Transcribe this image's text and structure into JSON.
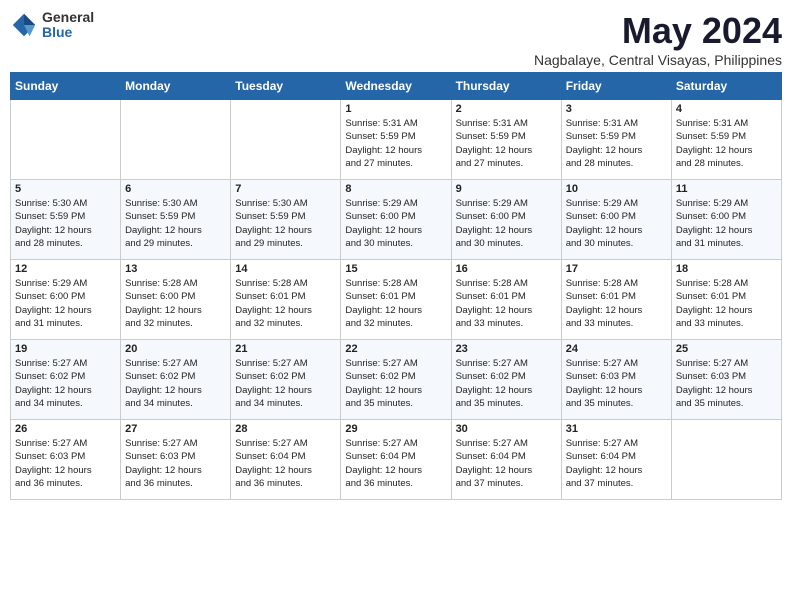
{
  "logo": {
    "general": "General",
    "blue": "Blue"
  },
  "title": "May 2024",
  "subtitle": "Nagbalaye, Central Visayas, Philippines",
  "days_header": [
    "Sunday",
    "Monday",
    "Tuesday",
    "Wednesday",
    "Thursday",
    "Friday",
    "Saturday"
  ],
  "weeks": [
    [
      {
        "num": "",
        "text": ""
      },
      {
        "num": "",
        "text": ""
      },
      {
        "num": "",
        "text": ""
      },
      {
        "num": "1",
        "text": "Sunrise: 5:31 AM\nSunset: 5:59 PM\nDaylight: 12 hours\nand 27 minutes."
      },
      {
        "num": "2",
        "text": "Sunrise: 5:31 AM\nSunset: 5:59 PM\nDaylight: 12 hours\nand 27 minutes."
      },
      {
        "num": "3",
        "text": "Sunrise: 5:31 AM\nSunset: 5:59 PM\nDaylight: 12 hours\nand 28 minutes."
      },
      {
        "num": "4",
        "text": "Sunrise: 5:31 AM\nSunset: 5:59 PM\nDaylight: 12 hours\nand 28 minutes."
      }
    ],
    [
      {
        "num": "5",
        "text": "Sunrise: 5:30 AM\nSunset: 5:59 PM\nDaylight: 12 hours\nand 28 minutes."
      },
      {
        "num": "6",
        "text": "Sunrise: 5:30 AM\nSunset: 5:59 PM\nDaylight: 12 hours\nand 29 minutes."
      },
      {
        "num": "7",
        "text": "Sunrise: 5:30 AM\nSunset: 5:59 PM\nDaylight: 12 hours\nand 29 minutes."
      },
      {
        "num": "8",
        "text": "Sunrise: 5:29 AM\nSunset: 6:00 PM\nDaylight: 12 hours\nand 30 minutes."
      },
      {
        "num": "9",
        "text": "Sunrise: 5:29 AM\nSunset: 6:00 PM\nDaylight: 12 hours\nand 30 minutes."
      },
      {
        "num": "10",
        "text": "Sunrise: 5:29 AM\nSunset: 6:00 PM\nDaylight: 12 hours\nand 30 minutes."
      },
      {
        "num": "11",
        "text": "Sunrise: 5:29 AM\nSunset: 6:00 PM\nDaylight: 12 hours\nand 31 minutes."
      }
    ],
    [
      {
        "num": "12",
        "text": "Sunrise: 5:29 AM\nSunset: 6:00 PM\nDaylight: 12 hours\nand 31 minutes."
      },
      {
        "num": "13",
        "text": "Sunrise: 5:28 AM\nSunset: 6:00 PM\nDaylight: 12 hours\nand 32 minutes."
      },
      {
        "num": "14",
        "text": "Sunrise: 5:28 AM\nSunset: 6:01 PM\nDaylight: 12 hours\nand 32 minutes."
      },
      {
        "num": "15",
        "text": "Sunrise: 5:28 AM\nSunset: 6:01 PM\nDaylight: 12 hours\nand 32 minutes."
      },
      {
        "num": "16",
        "text": "Sunrise: 5:28 AM\nSunset: 6:01 PM\nDaylight: 12 hours\nand 33 minutes."
      },
      {
        "num": "17",
        "text": "Sunrise: 5:28 AM\nSunset: 6:01 PM\nDaylight: 12 hours\nand 33 minutes."
      },
      {
        "num": "18",
        "text": "Sunrise: 5:28 AM\nSunset: 6:01 PM\nDaylight: 12 hours\nand 33 minutes."
      }
    ],
    [
      {
        "num": "19",
        "text": "Sunrise: 5:27 AM\nSunset: 6:02 PM\nDaylight: 12 hours\nand 34 minutes."
      },
      {
        "num": "20",
        "text": "Sunrise: 5:27 AM\nSunset: 6:02 PM\nDaylight: 12 hours\nand 34 minutes."
      },
      {
        "num": "21",
        "text": "Sunrise: 5:27 AM\nSunset: 6:02 PM\nDaylight: 12 hours\nand 34 minutes."
      },
      {
        "num": "22",
        "text": "Sunrise: 5:27 AM\nSunset: 6:02 PM\nDaylight: 12 hours\nand 35 minutes."
      },
      {
        "num": "23",
        "text": "Sunrise: 5:27 AM\nSunset: 6:02 PM\nDaylight: 12 hours\nand 35 minutes."
      },
      {
        "num": "24",
        "text": "Sunrise: 5:27 AM\nSunset: 6:03 PM\nDaylight: 12 hours\nand 35 minutes."
      },
      {
        "num": "25",
        "text": "Sunrise: 5:27 AM\nSunset: 6:03 PM\nDaylight: 12 hours\nand 35 minutes."
      }
    ],
    [
      {
        "num": "26",
        "text": "Sunrise: 5:27 AM\nSunset: 6:03 PM\nDaylight: 12 hours\nand 36 minutes."
      },
      {
        "num": "27",
        "text": "Sunrise: 5:27 AM\nSunset: 6:03 PM\nDaylight: 12 hours\nand 36 minutes."
      },
      {
        "num": "28",
        "text": "Sunrise: 5:27 AM\nSunset: 6:04 PM\nDaylight: 12 hours\nand 36 minutes."
      },
      {
        "num": "29",
        "text": "Sunrise: 5:27 AM\nSunset: 6:04 PM\nDaylight: 12 hours\nand 36 minutes."
      },
      {
        "num": "30",
        "text": "Sunrise: 5:27 AM\nSunset: 6:04 PM\nDaylight: 12 hours\nand 37 minutes."
      },
      {
        "num": "31",
        "text": "Sunrise: 5:27 AM\nSunset: 6:04 PM\nDaylight: 12 hours\nand 37 minutes."
      },
      {
        "num": "",
        "text": ""
      }
    ]
  ]
}
